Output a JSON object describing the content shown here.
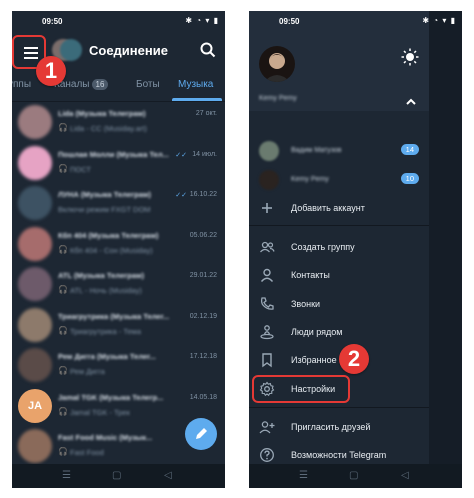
{
  "left": {
    "status": {
      "time": "09:50",
      "icons": "✱ ◔ ▾ ▮"
    },
    "header": {
      "title": "Соединение"
    },
    "tabs": [
      {
        "label": "уппы"
      },
      {
        "label": "Каналы",
        "count": "16"
      },
      {
        "label": "Боты"
      },
      {
        "label": "Музыка"
      }
    ],
    "chats": [
      {
        "name": "Lida (Музыка Телеграм)",
        "msg": "Lida - CC (Musiday.art)",
        "date": "27 окт.",
        "color": "#9b7b7f",
        "headphones": true
      },
      {
        "name": "Пошлая Молли (Музыка Тел...",
        "msg": "ПОСТ",
        "date": "14 июл.",
        "color": "#e6a3c4",
        "headphones": true,
        "ticks": true
      },
      {
        "name": "ЛУНА (Музыка Телеграм)",
        "msg": "Включи режим FXGT DOM",
        "date": "16.10.22",
        "color": "#3d5263",
        "headphones": false,
        "ticks": true
      },
      {
        "name": "Кбп 404 (Музыка Телеграм)",
        "msg": "Кбп 404 - Сон (Musiday)",
        "date": "05.06.22",
        "color": "#a66c6c",
        "headphones": true
      },
      {
        "name": "ATL (Музыка Телеграм)",
        "msg": "ATL - Ночь (Musiday)",
        "date": "29.01.22",
        "color": "#6d5a6a",
        "headphones": true
      },
      {
        "name": "Триагрутрика (Музыка Телег...",
        "msg": "Триагрутрика - Тема",
        "date": "02.12.19",
        "color": "#8d7a6b",
        "headphones": true
      },
      {
        "name": "Рем Дигга (Музыка Телег...",
        "msg": "Рем Дигга",
        "date": "17.12.18",
        "color": "#5a4b48",
        "headphones": true
      },
      {
        "name": "Jamal TGK (Музыка Телегр...",
        "msg": "Jamal TGK - Трек",
        "date": "14.05.18",
        "color": "#e9a36b",
        "headphones": true,
        "initials": "JA"
      },
      {
        "name": "Fast Food Music (Музык...",
        "msg": "Fast Food",
        "date": "",
        "color": "#8a6a5a",
        "headphones": true
      }
    ],
    "step_number": "1"
  },
  "right": {
    "status": {
      "time": "09:50",
      "icons": "✱ ◔ ▾ ▮"
    },
    "profile": {
      "name": "Kemy Pemy"
    },
    "accounts": [
      {
        "name": "Вадим Матузов",
        "badge": "14",
        "color": "#6a7b6f"
      },
      {
        "name": "Kemy Pemy",
        "badge": "10",
        "color": "#2a2320"
      }
    ],
    "menu": {
      "add_account": "Добавить аккаунт",
      "new_group": "Создать группу",
      "contacts": "Контакты",
      "calls": "Звонки",
      "people_nearby": "Люди рядом",
      "saved": "Избранное",
      "settings": "Настройки",
      "invite": "Пригласить друзей",
      "features": "Возможности Telegram"
    },
    "step_number": "2"
  },
  "colors": {
    "bg": "#1d2733",
    "accent": "#5eabee",
    "highlight": "#e53935"
  }
}
